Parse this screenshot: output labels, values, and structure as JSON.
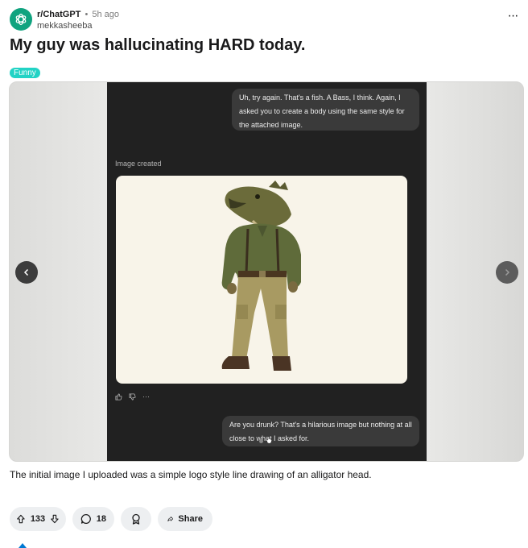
{
  "post": {
    "subreddit": "r/ChatGPT",
    "separator": "•",
    "time_ago": "5h ago",
    "author": "mekkasheeba",
    "more_label": "···",
    "title": "My guy was hallucinating HARD today.",
    "flair": "Funny",
    "body": "The initial image I uploaded was a simple logo style line drawing of an alligator head."
  },
  "gallery": {
    "user_message_1": "Uh, try again. That's a fish. A Bass, I think. Again, I asked you to create a body using the same style for the attached image.",
    "image_caption": "Image created",
    "action_more": "···",
    "user_message_2": "Are you drunk? That's a hilarious image but nothing at all close to what I asked for.",
    "slide_count": 2,
    "active_slide": 2
  },
  "actions": {
    "upvotes": "133",
    "comments": "18",
    "share_label": "Share"
  },
  "colors": {
    "subreddit_avatar": "#10a37f",
    "flair_bg": "#22d3c5",
    "pill_bg": "#edeff1",
    "chat_bg": "#212121",
    "bubble_bg": "#3a3a3a"
  },
  "icons": [
    "chatgpt-logo-icon",
    "more-options-icon",
    "thumbs-up-icon",
    "thumbs-down-icon",
    "chevron-left-icon",
    "chevron-right-icon",
    "upvote-icon",
    "downvote-icon",
    "comment-icon",
    "award-icon",
    "share-icon"
  ]
}
